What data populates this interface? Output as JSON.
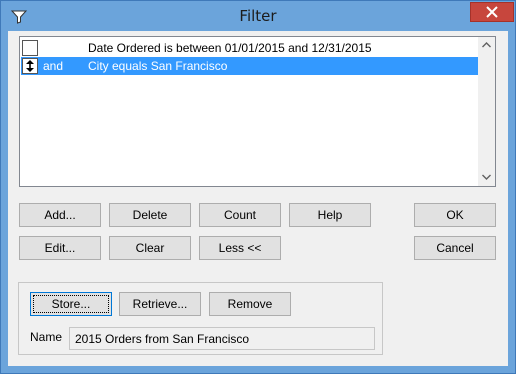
{
  "window": {
    "title": "Filter",
    "icon": "filter-icon",
    "close_icon": "close-icon"
  },
  "criteria": [
    {
      "conjunction": "",
      "condition": "Date Ordered is between 01/01/2015 and 12/31/2015",
      "selected": false
    },
    {
      "conjunction": "and",
      "condition": "City equals San Francisco",
      "selected": true,
      "indicator_icon": "up-down-arrow-icon"
    }
  ],
  "buttons": {
    "add": "Add...",
    "delete": "Delete",
    "count": "Count",
    "help": "Help",
    "ok": "OK",
    "edit": "Edit...",
    "clear": "Clear",
    "less": "Less <<",
    "cancel": "Cancel"
  },
  "storage": {
    "store": "Store...",
    "retrieve": "Retrieve...",
    "remove": "Remove",
    "name_label": "Name",
    "name_value": "2015 Orders from San Francisco"
  },
  "colors": {
    "accent": "#3399ff",
    "title_bar": "#6ba4db",
    "close": "#c7463d"
  }
}
